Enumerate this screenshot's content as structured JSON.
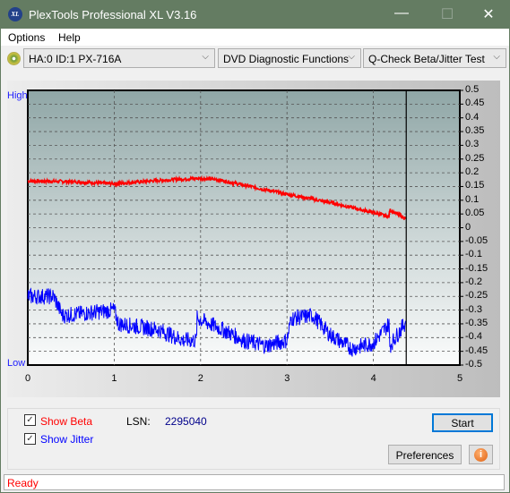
{
  "window": {
    "title": "PlexTools Professional XL V3.16",
    "logo": "XL",
    "minimize": "—",
    "maximize": "☐",
    "close": "✕"
  },
  "menu": {
    "options": "Options",
    "help": "Help"
  },
  "toolbar": {
    "drive": "HA:0 ID:1  PX-716A",
    "function": "DVD Diagnostic Functions",
    "test": "Q-Check Beta/Jitter Test"
  },
  "chart_data": {
    "type": "line",
    "left_labels": {
      "high": "High",
      "low": "Low"
    },
    "xlim": [
      0,
      5
    ],
    "ylim": [
      -0.5,
      0.5
    ],
    "x_ticks": [
      "0",
      "1",
      "2",
      "3",
      "4",
      "5"
    ],
    "y_ticks": [
      "0.5",
      "0.45",
      "0.4",
      "0.35",
      "0.3",
      "0.25",
      "0.2",
      "0.15",
      "0.1",
      "0.05",
      "0",
      "-0.05",
      "-0.1",
      "-0.15",
      "-0.2",
      "-0.25",
      "-0.3",
      "-0.35",
      "-0.4",
      "-0.45",
      "-0.5"
    ],
    "grid": true,
    "marker_x": 4.38,
    "series": [
      {
        "key": "beta",
        "color": "#ff0000",
        "points": [
          [
            0,
            0.17
          ],
          [
            0.5,
            0.168
          ],
          [
            1,
            0.16
          ],
          [
            1.5,
            0.172
          ],
          [
            2,
            0.18
          ],
          [
            2.2,
            0.175
          ],
          [
            2.5,
            0.155
          ],
          [
            3,
            0.122
          ],
          [
            3.5,
            0.092
          ],
          [
            4,
            0.055
          ],
          [
            4.18,
            0.04
          ],
          [
            4.19,
            0.065
          ],
          [
            4.38,
            0.032
          ]
        ]
      },
      {
        "key": "jitter",
        "color": "#0000ff",
        "points": [
          [
            0,
            -0.25
          ],
          [
            0.3,
            -0.25
          ],
          [
            0.4,
            -0.32
          ],
          [
            1,
            -0.3
          ],
          [
            1.05,
            -0.35
          ],
          [
            1.5,
            -0.37
          ],
          [
            1.8,
            -0.41
          ],
          [
            1.95,
            -0.41
          ],
          [
            1.96,
            -0.33
          ],
          [
            2.25,
            -0.37
          ],
          [
            2.5,
            -0.41
          ],
          [
            2.75,
            -0.43
          ],
          [
            3,
            -0.41
          ],
          [
            3.05,
            -0.33
          ],
          [
            3.3,
            -0.32
          ],
          [
            3.5,
            -0.39
          ],
          [
            3.75,
            -0.44
          ],
          [
            4,
            -0.42
          ],
          [
            4.18,
            -0.35
          ],
          [
            4.19,
            -0.43
          ],
          [
            4.38,
            -0.34
          ]
        ]
      }
    ]
  },
  "controls": {
    "show_beta": "Show Beta",
    "show_jitter": "Show Jitter",
    "lsn_label": "LSN:",
    "lsn_value": "2295040",
    "start": "Start",
    "preferences": "Preferences",
    "info_icon": "i",
    "beta_color": "#ff0000",
    "jitter_color": "#0000ff"
  },
  "status": "Ready"
}
